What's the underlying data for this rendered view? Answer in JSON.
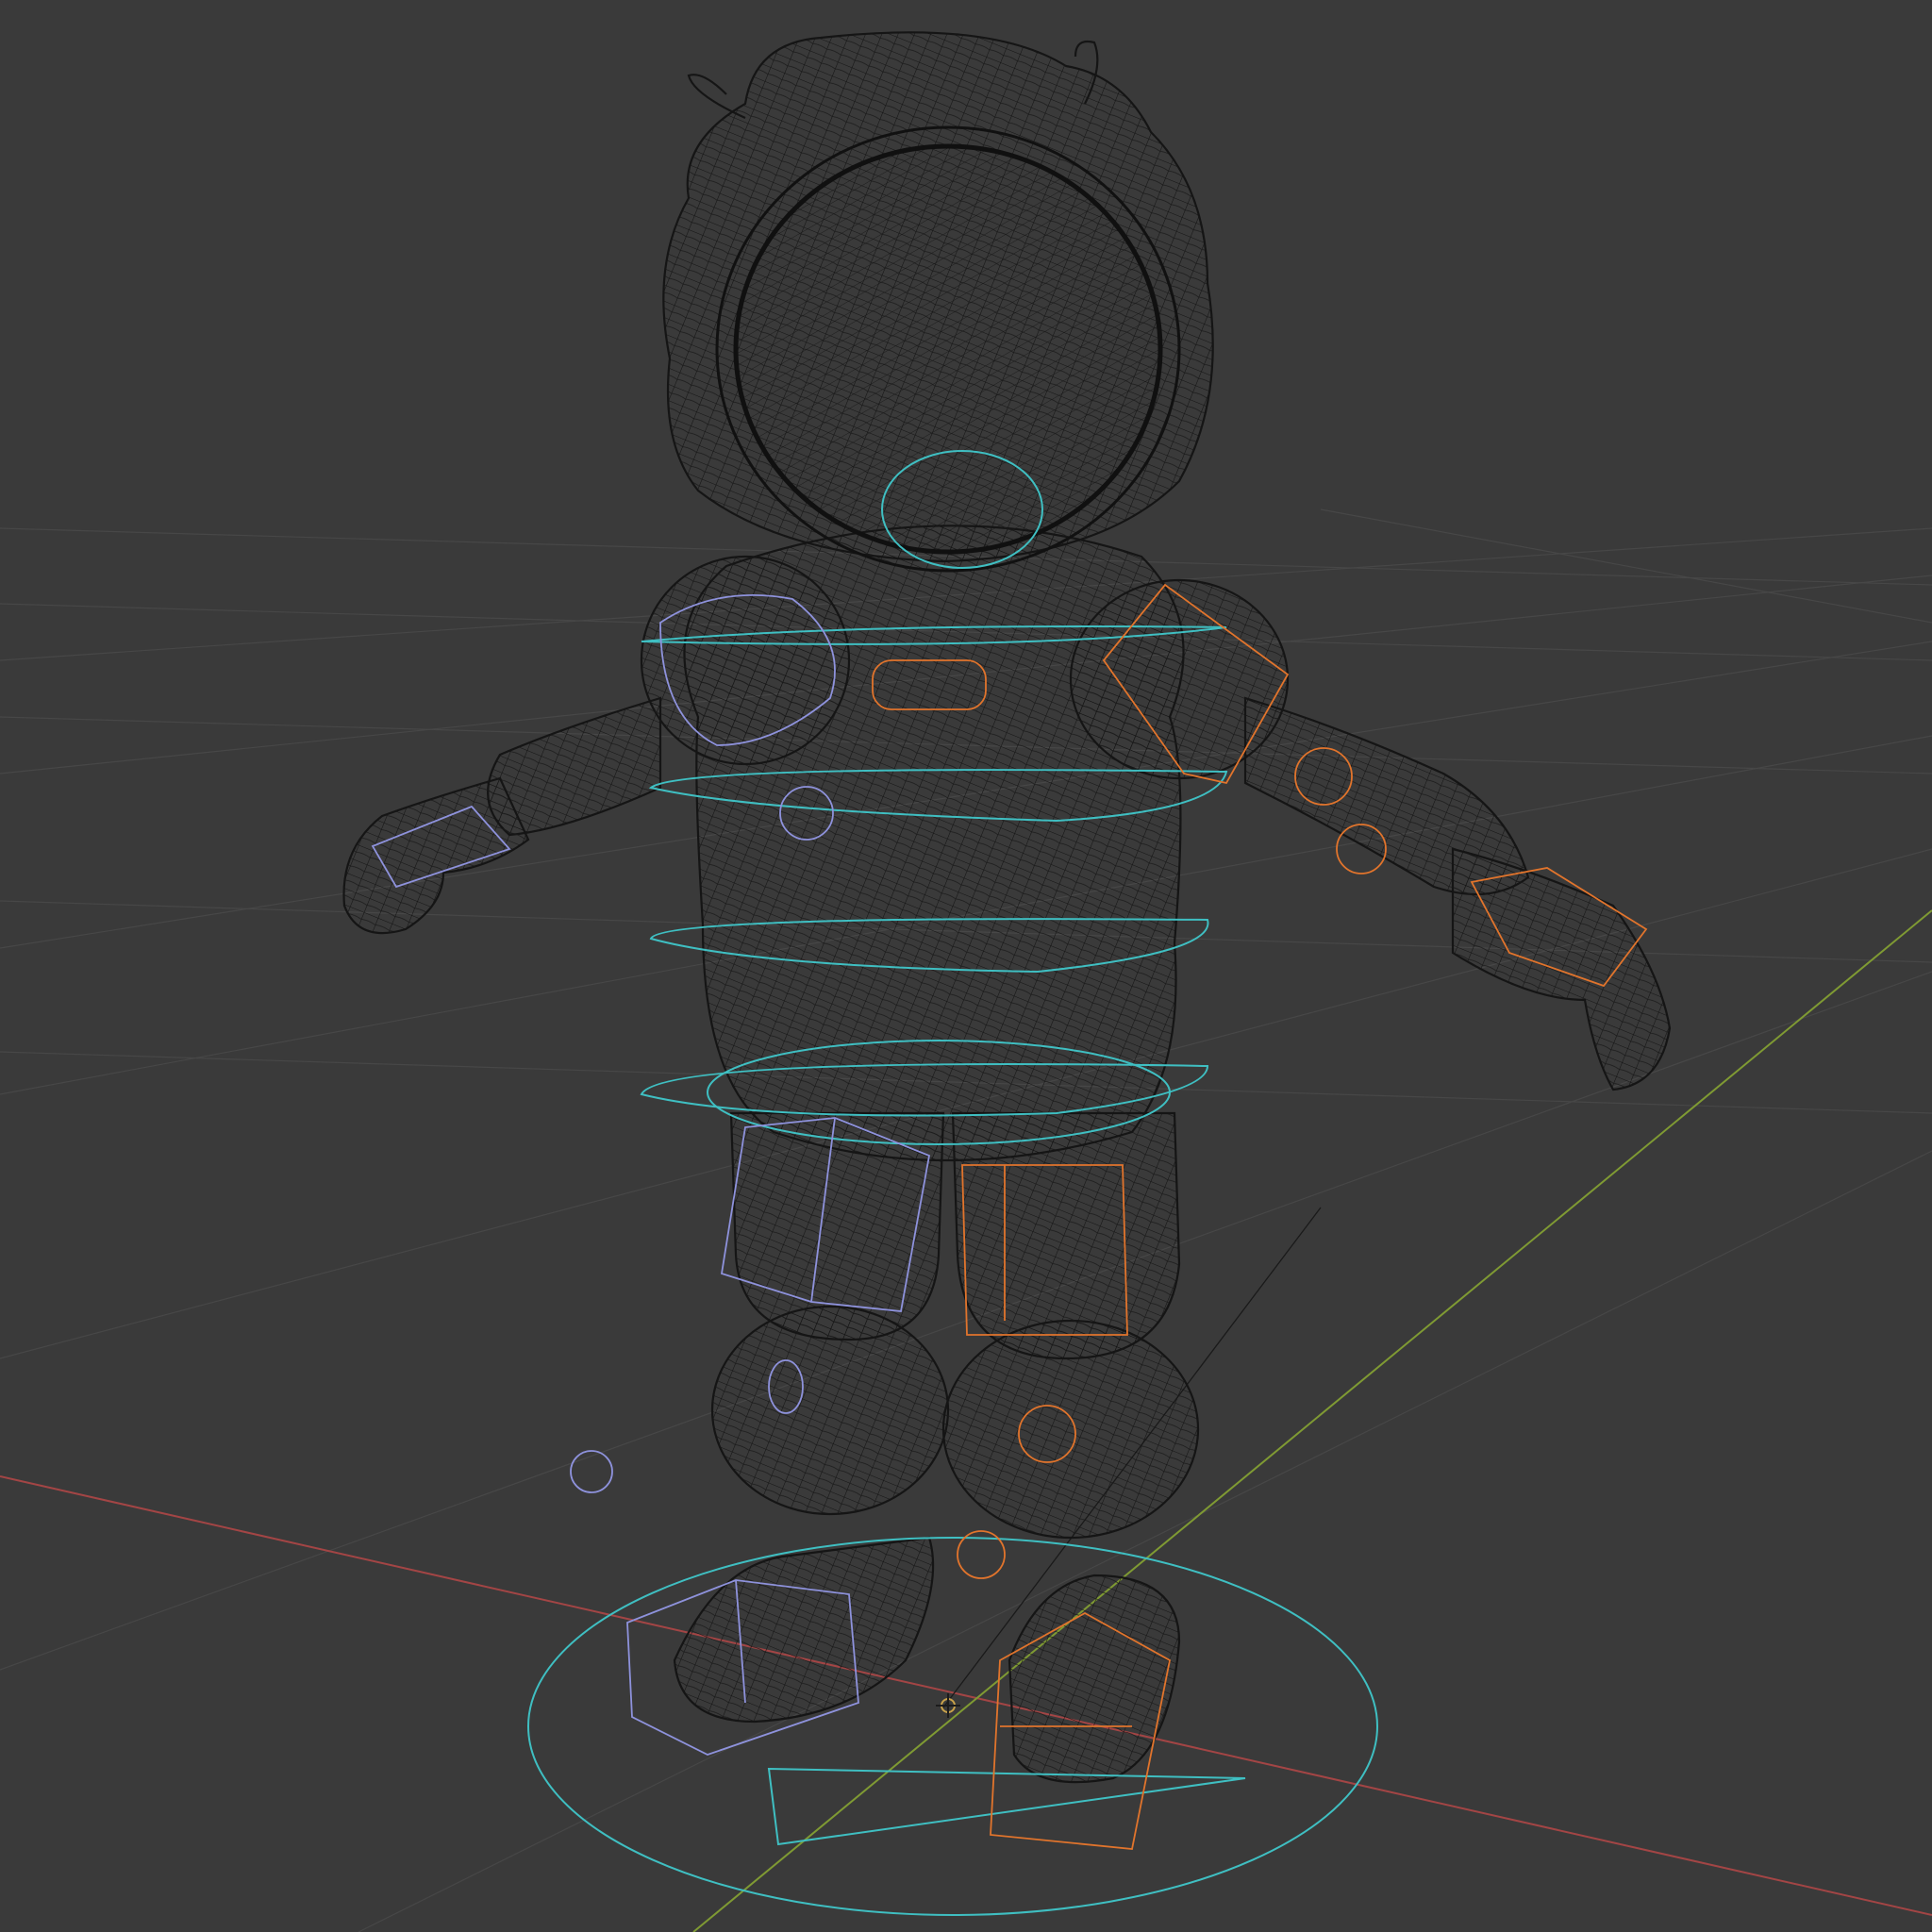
{
  "viewport": {
    "background_color": "#3a3a3a",
    "shading_mode": "wireframe",
    "grid_color": "#474747",
    "x_axis_color": "#a34545",
    "y_axis_color": "#7f9a33",
    "mesh_wire_color": "#151515",
    "left_controls_color": "#8e92dc",
    "right_controls_color": "#e1742c",
    "center_controls_color": "#3fbfc2",
    "origin_icon": "scene-origin-icon"
  }
}
